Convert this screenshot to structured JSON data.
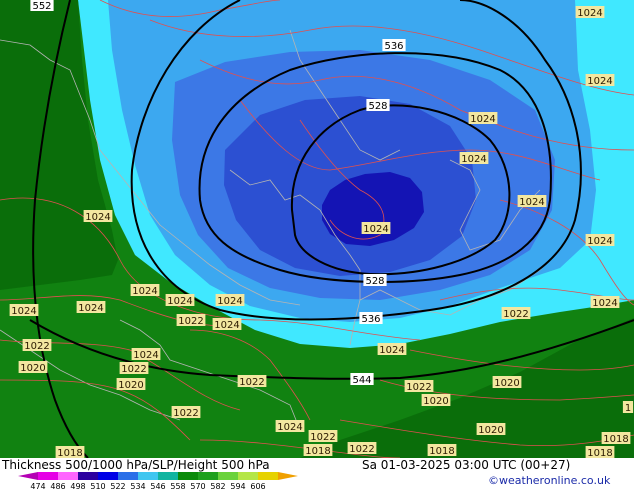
{
  "footer": {
    "title": "Thickness 500/1000 hPa/SLP/Height 500 hPa",
    "datetime": "Sa 01-03-2025 03:00 UTC (00+27)",
    "credit": "©weatheronline.co.uk"
  },
  "scale": {
    "labels": [
      "474",
      "486",
      "498",
      "510",
      "522",
      "534",
      "546",
      "558",
      "570",
      "582",
      "594",
      "606"
    ],
    "colors": [
      "#b400b4",
      "#e600e6",
      "#ff66ff",
      "#2c00a0",
      "#0000e6",
      "#2a6fe8",
      "#3fc6f0",
      "#11b4a0",
      "#0a8a0a",
      "#1ea01e",
      "#6ad23c",
      "#b4e646",
      "#e6d200",
      "#f0a000"
    ]
  },
  "map": {
    "colors": {
      "green_dark": "#0a6e0a",
      "green_mid": "#118211",
      "cyan": "#40e8ff",
      "sky_blue": "#3ca8f0",
      "blue": "#3c78e6",
      "royal_blue": "#2c50d2",
      "deep_blue": "#1414b4",
      "isobar": "#e05050",
      "height_contour": "#000000",
      "coast": "#b4b4b4",
      "label_bg": "#f3e7a0"
    },
    "height_labels": [
      "552",
      "536",
      "528",
      "528",
      "536",
      "544"
    ],
    "pressure_labels": [
      "1024",
      "1024",
      "1024",
      "1024",
      "1024",
      "1024",
      "1024",
      "1024",
      "1024",
      "1024",
      "1024",
      "1024",
      "1024",
      "1024",
      "1024",
      "1024",
      "1022",
      "1022",
      "1022",
      "1022",
      "1022",
      "1022",
      "1022",
      "1022",
      "1020",
      "1020",
      "1020",
      "1020",
      "1020",
      "1018",
      "1018",
      "1018",
      "1018",
      "1024",
      "1024",
      "1022",
      "1018",
      "1"
    ]
  }
}
